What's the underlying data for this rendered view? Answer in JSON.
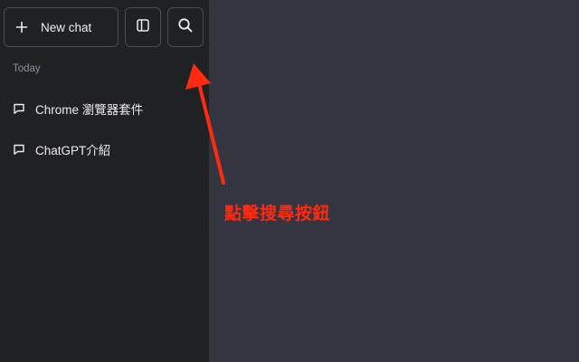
{
  "sidebar": {
    "new_chat_label": "New chat",
    "section_label": "Today",
    "chats": [
      {
        "label": "Chrome 瀏覽器套件"
      },
      {
        "label": "ChatGPT介紹"
      }
    ]
  },
  "icons": {
    "new_chat": "plus-icon",
    "toggle_sidebar": "sidebar-toggle-icon",
    "search": "search-icon",
    "chat": "chat-bubble-icon"
  },
  "annotation": {
    "text": "點擊搜尋按鈕",
    "color": "#ff2a0f"
  },
  "colors": {
    "sidebar_bg": "#202123",
    "main_bg": "#343541",
    "border": "#4d4d4f",
    "text": "#ececf1",
    "muted_text": "#8e8ea0"
  }
}
